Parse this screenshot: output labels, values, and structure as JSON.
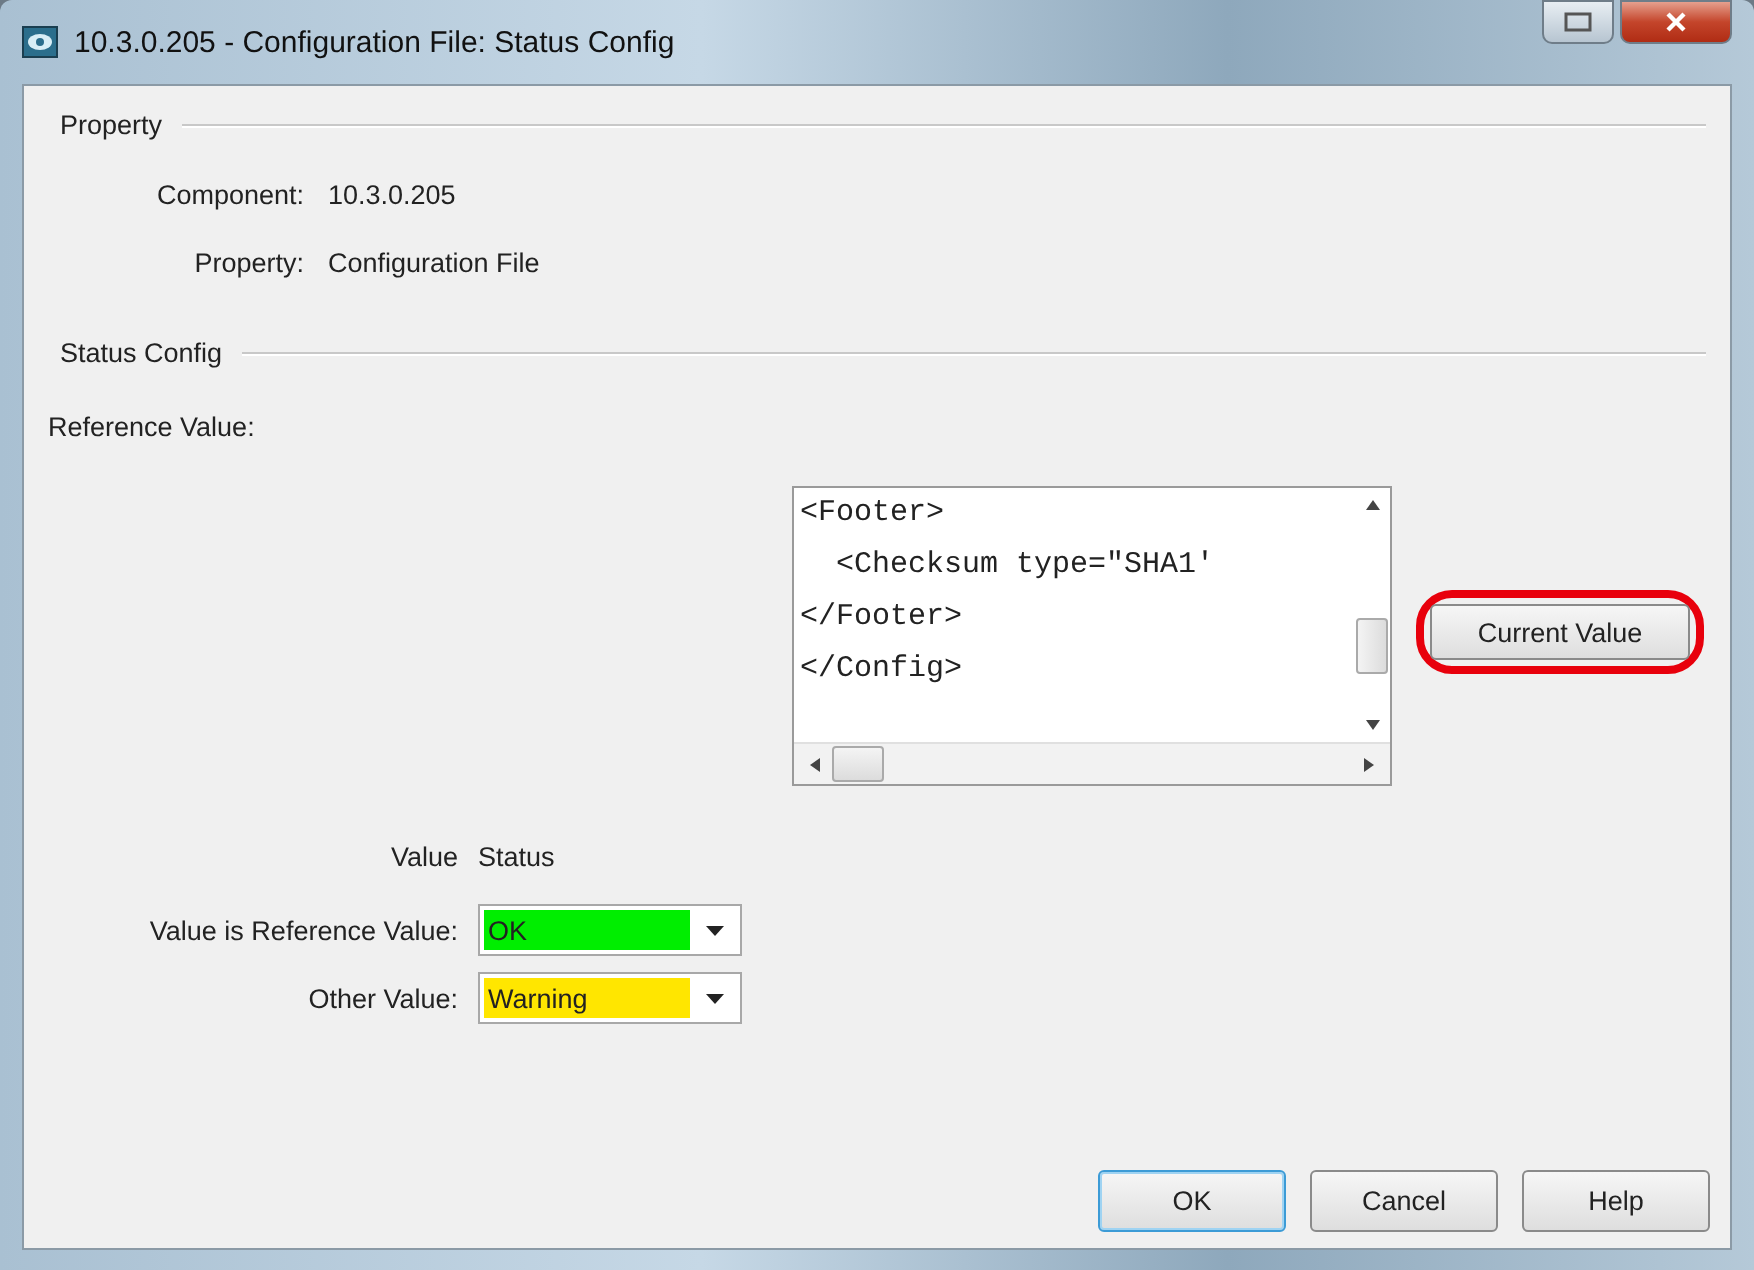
{
  "window": {
    "title": "10.3.0.205 - Configuration File: Status Config"
  },
  "property_section": {
    "title": "Property",
    "fields": [
      {
        "label": "Component:",
        "value": "10.3.0.205"
      },
      {
        "label": "Property:",
        "value": "Configuration File"
      }
    ]
  },
  "status_section": {
    "title": "Status Config",
    "reference_label": "Reference Value:",
    "reference_text": [
      "<Footer>",
      "  <Checksum type=\"SHA1'",
      "</Footer>",
      "</Config>"
    ],
    "current_value_button": {
      "label": "Current Value",
      "highlighted": true
    },
    "table_headers": [
      "Value",
      "Status"
    ],
    "rows": [
      {
        "label": "Value is Reference Value:",
        "status": "OK",
        "color": "#00ee00"
      },
      {
        "label": "Other Value:",
        "status": "Warning",
        "color": "#ffe600"
      }
    ]
  },
  "buttons": [
    {
      "label": "OK",
      "default": true
    },
    {
      "label": "Cancel",
      "default": false
    },
    {
      "label": "Help",
      "default": false
    }
  ]
}
